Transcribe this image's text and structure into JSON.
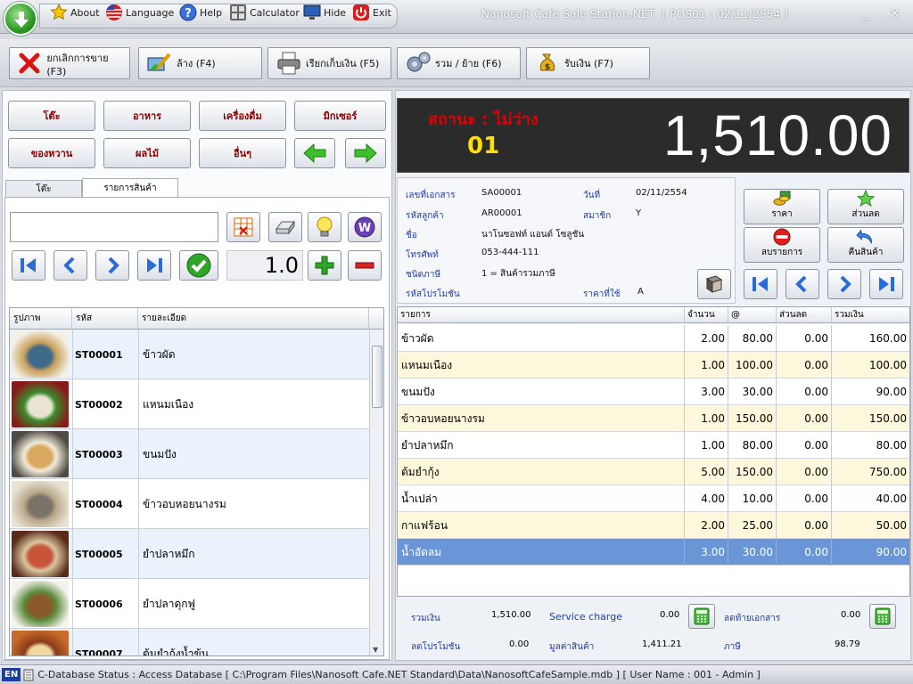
{
  "app": {
    "title": "Nanosoft Cafe Sale Station.NET",
    "pos_info": "[ POS01 : 02/11/2554 ]"
  },
  "quick": {
    "about": "About",
    "language": "Language",
    "help": "Help",
    "calculator": "Calculator",
    "hide": "Hide",
    "exit": "Exit"
  },
  "window_controls": {
    "minimize": "_",
    "close": "✕"
  },
  "toolbar": [
    {
      "label": "ยกเลิกการขาย (F3)",
      "icon": "cancel-x-icon"
    },
    {
      "label": "ล้าง (F4)",
      "icon": "clear-brush-icon"
    },
    {
      "label": "เรียกเก็บเงิน (F5)",
      "icon": "printer-icon"
    },
    {
      "label": "รวม / ย้าย (F6)",
      "icon": "gears-icon"
    },
    {
      "label": "รับเงิน (F7)",
      "icon": "money-bag-icon"
    }
  ],
  "categories": {
    "row1": [
      "โต๊ะ",
      "อาหาร",
      "เครื่องดื่ม",
      "มิกเซอร์"
    ],
    "row2": [
      "ของหวาน",
      "ผลไม้",
      "อื่นๆ"
    ]
  },
  "tabs": [
    "โต๊ะ",
    "รายการสินค้า"
  ],
  "search": {
    "value": "",
    "placeholder": ""
  },
  "quantity": "1.0",
  "product_grid": {
    "headers": [
      "รูปภาพ",
      "รหัส",
      "รายละเอียด"
    ],
    "rows": [
      {
        "code": "ST00001",
        "desc": "ข้าวผัด"
      },
      {
        "code": "ST00002",
        "desc": "แหนมเนือง"
      },
      {
        "code": "ST00003",
        "desc": "ขนมปัง"
      },
      {
        "code": "ST00004",
        "desc": "ข้าวอบหอยนางรม"
      },
      {
        "code": "ST00005",
        "desc": "ยำปลาหมึก"
      },
      {
        "code": "ST00006",
        "desc": "ยำปลาดุกฟู"
      },
      {
        "code": "ST00007",
        "desc": "ต้มยำกุ้งน้ำข้น"
      }
    ]
  },
  "status": {
    "label": "สถานะ : ไม่ว่าง",
    "table": "01",
    "total": "1,510.00"
  },
  "info": {
    "doc_no_label": "เลขที่เอกสาร",
    "doc_no": "SA00001",
    "date_label": "วันที่",
    "date": "02/11/2554",
    "cust_code_label": "รหัสลูกค้า",
    "cust_code": "AR00001",
    "member_label": "สมาชิก",
    "member": "Y",
    "name_label": "ชื่อ",
    "name": "นาโนซอฟท์ แอนด์ โซลูชัน",
    "phone_label": "โทรศัพท์",
    "phone": "053-444-111",
    "tax_label": "ชนิดภาษี",
    "tax": "1 = สินค้ารวมภาษี",
    "promo_label": "รหัสโปรโมชัน",
    "promo": "",
    "price_label": "ราคาที่ใช้",
    "price": "A"
  },
  "actions": {
    "price": "ราคา",
    "discount": "ส่วนลด",
    "delete": "ลบรายการ",
    "return": "คืนสินค้า"
  },
  "order_grid": {
    "headers": [
      "รายการ",
      "จำนวน",
      "@",
      "ส่วนลด",
      "รวมเงิน"
    ],
    "rows": [
      {
        "item": "ข้าวผัด",
        "qty": "2.00",
        "price": "80.00",
        "disc": "0.00",
        "total": "160.00"
      },
      {
        "item": "แหนมเนือง",
        "qty": "1.00",
        "price": "100.00",
        "disc": "0.00",
        "total": "100.00"
      },
      {
        "item": "ขนมปัง",
        "qty": "3.00",
        "price": "30.00",
        "disc": "0.00",
        "total": "90.00"
      },
      {
        "item": "ข้าวอบหอยนางรม",
        "qty": "1.00",
        "price": "150.00",
        "disc": "0.00",
        "total": "150.00"
      },
      {
        "item": "ยำปลาหมึก",
        "qty": "1.00",
        "price": "80.00",
        "disc": "0.00",
        "total": "80.00"
      },
      {
        "item": "ต้มยำกุ้ง",
        "qty": "5.00",
        "price": "150.00",
        "disc": "0.00",
        "total": "750.00"
      },
      {
        "item": "น้ำเปล่า",
        "qty": "4.00",
        "price": "10.00",
        "disc": "0.00",
        "total": "40.00"
      },
      {
        "item": "กาแฟร้อน",
        "qty": "2.00",
        "price": "25.00",
        "disc": "0.00",
        "total": "50.00"
      },
      {
        "item": "น้ำอัดลม",
        "qty": "3.00",
        "price": "30.00",
        "disc": "0.00",
        "total": "90.00"
      }
    ]
  },
  "summary": {
    "sum_label": "รวมเงิน",
    "sum": "1,510.00",
    "service_label": "Service charge",
    "service": "0.00",
    "end_disc_label": "ลดท้ายเอกสาร",
    "end_disc": "0.00",
    "promo_disc_label": "ลดโปรโมชัน",
    "promo_disc": "0.00",
    "goods_label": "มูลค่าสินค้า",
    "goods": "1,411.21",
    "vat_label": "ภาษี",
    "vat": "98.79"
  },
  "statusbar": {
    "lang": "EN",
    "text": "C-Database Status : Access Database [ C:\\Program Files\\Nanosoft Cafe.NET Standard\\Data\\NanosoftCafeSample.mdb ]  [ User Name : 001 - Admin ]"
  },
  "colors": {
    "status_red": "#e00000",
    "table_yellow": "#ffe000",
    "selected_row": "#6a95d6",
    "alt_row": "#fdf8dc",
    "category_text": "#8a0000"
  }
}
